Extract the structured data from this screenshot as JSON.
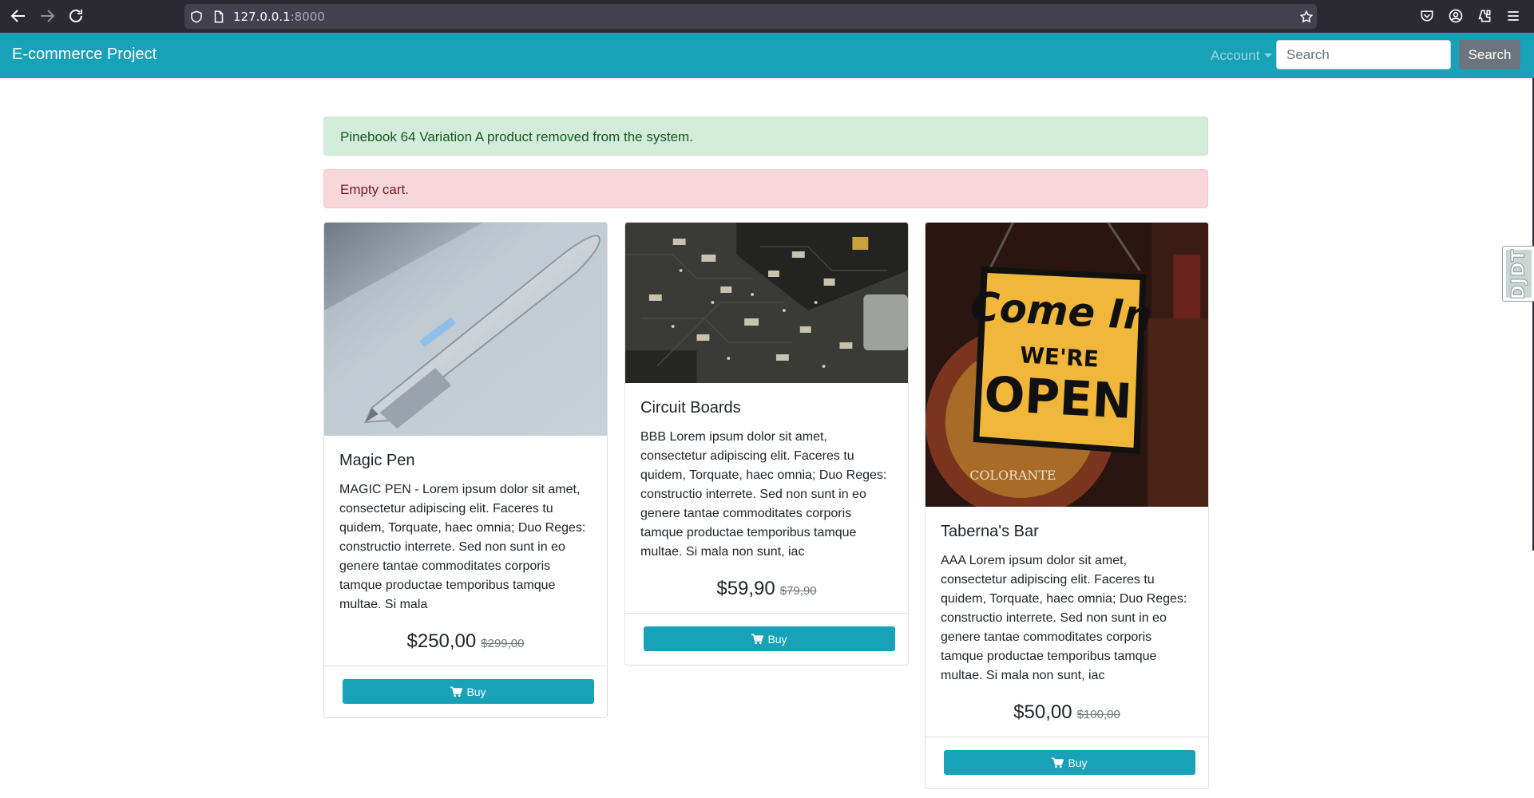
{
  "browser": {
    "url_host": "127.0.0.1",
    "url_port": ":8000"
  },
  "navbar": {
    "brand": "E-commerce Project",
    "account_label": "Account",
    "search_placeholder": "Search",
    "search_button": "Search",
    "color": "#17a2b8"
  },
  "alerts": {
    "success": "Pinebook 64 Variation A product removed from the system.",
    "danger": "Empty cart."
  },
  "products": [
    {
      "title": "Magic Pen",
      "description": "MAGIC PEN - Lorem ipsum dolor sit amet, consectetur adipiscing elit. Faceres tu quidem, Torquate, haec omnia; Duo Reges: constructio interrete. Sed non sunt in eo genere tantae commoditates corporis tamque productae temporibus tamque multae. Si mala",
      "price": "$250,00",
      "old_price": "$299,00",
      "buy_label": "Buy"
    },
    {
      "title": "Circuit Boards",
      "description": "BBB Lorem ipsum dolor sit amet, consectetur adipiscing elit. Faceres tu quidem, Torquate, haec omnia; Duo Reges: constructio interrete. Sed non sunt in eo genere tantae commoditates corporis tamque productae temporibus tamque multae. Si mala non sunt, iac",
      "price": "$59,90",
      "old_price": "$79,90",
      "buy_label": "Buy"
    },
    {
      "title": "Taberna's Bar",
      "description": "AAA Lorem ipsum dolor sit amet, consectetur adipiscing elit. Faceres tu quidem, Torquate, haec omnia; Duo Reges: constructio interrete. Sed non sunt in eo genere tantae commoditates corporis tamque productae temporibus tamque multae. Si mala non sunt, iac",
      "price": "$50,00",
      "old_price": "$100,00",
      "buy_label": "Buy",
      "sign_text": [
        "Come In",
        "WE'RE",
        "OPEN"
      ],
      "sign_caption": "COLORANTE"
    }
  ],
  "debug_toolbar": {
    "label": "DJDT"
  }
}
